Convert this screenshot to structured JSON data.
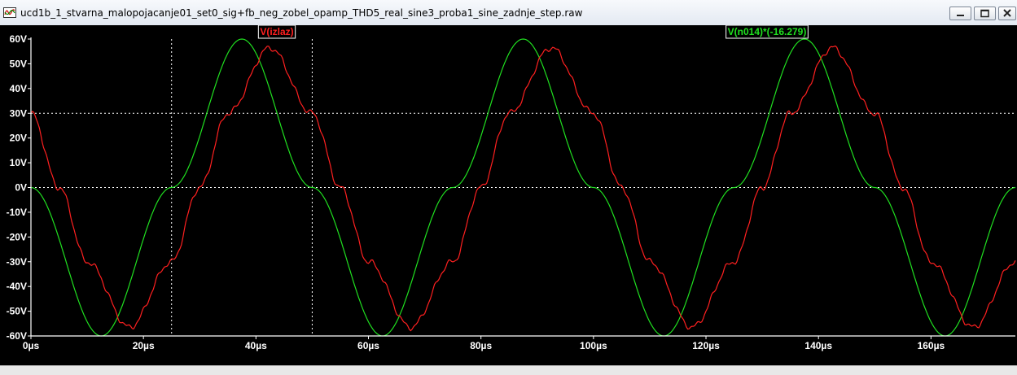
{
  "window": {
    "title": "ucd1b_1_stvarna_malopojacanje01_set0_sig+fb_neg_zobel_opamp_THD5_real_sine3_proba1_sine_zadnje_step.raw",
    "app_icon": "waveform-icon",
    "buttons": [
      "minimize-icon",
      "restore-icon",
      "close-icon"
    ]
  },
  "colors": {
    "background": "#000000",
    "axis": "#ffffff",
    "red_trace": "#ff2020",
    "green_trace": "#20e020",
    "label_red_bg": "#ffffff",
    "label_green_bg": "#ffffff"
  },
  "chart_data": {
    "type": "line",
    "x_unit": "µs",
    "y_unit": "V",
    "xlim": [
      0,
      175
    ],
    "ylim": [
      -60,
      60
    ],
    "x_ticks": [
      "0µs",
      "20µs",
      "40µs",
      "60µs",
      "80µs",
      "100µs",
      "120µs",
      "140µs",
      "160µs"
    ],
    "x_tick_values": [
      0,
      20,
      40,
      60,
      80,
      100,
      120,
      140,
      160
    ],
    "y_ticks": [
      "60V",
      "50V",
      "40V",
      "30V",
      "20V",
      "10V",
      "0V",
      "-10V",
      "-20V",
      "-30V",
      "-40V",
      "-50V",
      "-60V"
    ],
    "y_tick_values": [
      60,
      50,
      40,
      30,
      20,
      10,
      0,
      -10,
      -20,
      -30,
      -40,
      -50,
      -60
    ],
    "cursor_lines": {
      "x": [
        25,
        50
      ],
      "y": [
        30,
        0
      ]
    },
    "series": [
      {
        "name": "V(n014)*(-16.279)",
        "color": "#20e020",
        "x": [
          0,
          12.5,
          25,
          37.5,
          50,
          62.5,
          75,
          87.5,
          100,
          112.5,
          125,
          137.5,
          150,
          162.5,
          175
        ],
        "y": [
          0,
          -60,
          0,
          60,
          0,
          -60,
          0,
          60,
          0,
          -60,
          0,
          60,
          0,
          -60,
          0
        ]
      },
      {
        "name": "V(izlaz)",
        "color": "#ff2020",
        "x": [
          0,
          5,
          10,
          17.5,
          25,
          30,
          35,
          42.5,
          50,
          55,
          60,
          67.5,
          75,
          80,
          85,
          92.5,
          100,
          105,
          110,
          117.5,
          125,
          130,
          135,
          142.5,
          150,
          155,
          160,
          167.5,
          175
        ],
        "y": [
          30,
          0,
          -30,
          -56.5,
          -30,
          0,
          30,
          56.5,
          30,
          0,
          -30,
          -56.5,
          -30,
          0,
          30,
          56.5,
          30,
          0,
          -30,
          -56.5,
          -30,
          0,
          30,
          56.5,
          30,
          0,
          -30,
          -56.5,
          -30
        ]
      }
    ]
  }
}
